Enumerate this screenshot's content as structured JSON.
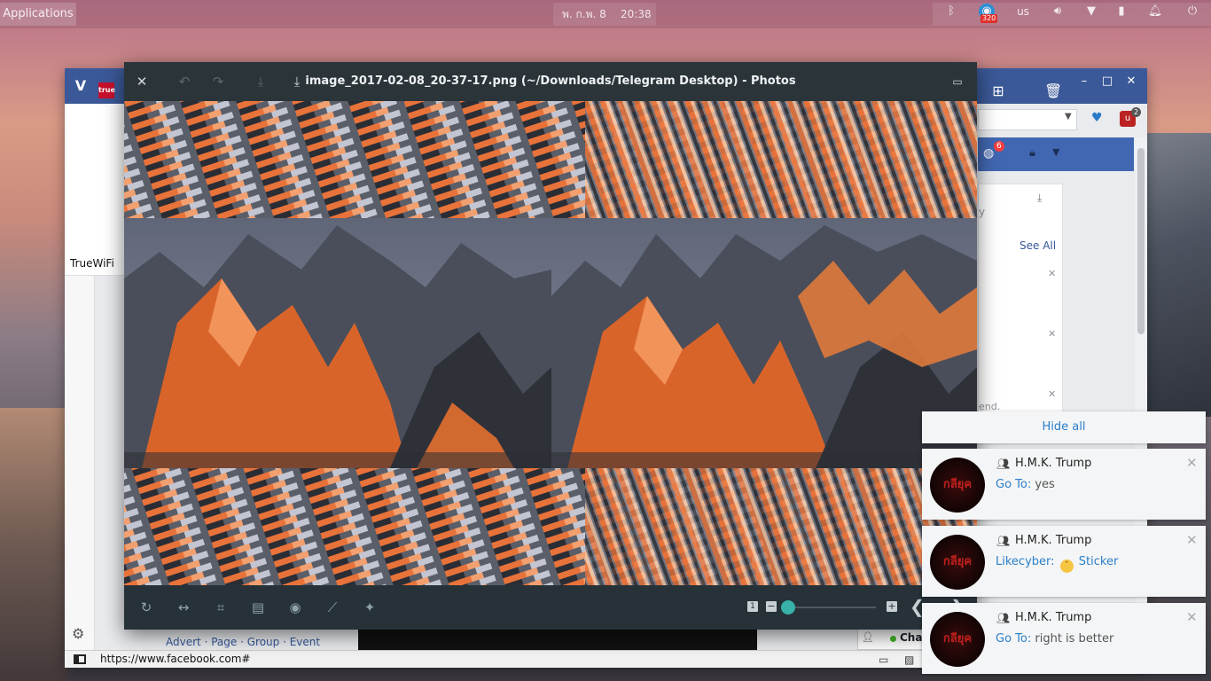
{
  "panel": {
    "applications": "Applications",
    "date": "พ. ก.พ. 8",
    "time": "20:38",
    "badge": "320",
    "keyboard": "us"
  },
  "browser": {
    "left_tab_label": "TrueWiFi",
    "see_all": "See All",
    "partial_text_1": "y",
    "partial_text_2": "end.",
    "notif_badge": "6",
    "ext_badge": "2",
    "footer": {
      "advert": "Advert",
      "page": "Page",
      "group": "Group",
      "event": "Event",
      "sep": " · "
    },
    "chat_label": "Chat",
    "status_url": "https://www.facebook.com#"
  },
  "photos": {
    "title": "image_2017-02-08_20-37-17.png (~/Downloads/Telegram Desktop) - Photos",
    "zoom_one": "1",
    "zoom_fraction": 0.0
  },
  "notifications": {
    "hide_all": "Hide all",
    "items": [
      {
        "name": "H.M.K. Trump",
        "from": "Go To:",
        "text": " yes",
        "avatar_text": "กลียุค"
      },
      {
        "name": "H.M.K. Trump",
        "from": "Likecyber:",
        "text": "Sticker",
        "avatar_text": "กลียุค"
      },
      {
        "name": "H.M.K. Trump",
        "from": "Go To:",
        "text": " right is better",
        "avatar_text": "กลียุค"
      }
    ]
  }
}
